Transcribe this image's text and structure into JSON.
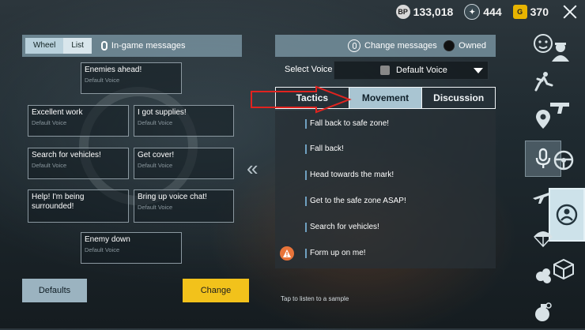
{
  "currency": {
    "bp_label": "BP",
    "bp_value": "133,018",
    "uc_value": "444",
    "g_label": "G",
    "g_value": "370"
  },
  "left_panel": {
    "tabs": [
      "Wheel",
      "List"
    ],
    "ingame_label": "In-game messages",
    "slots": [
      {
        "title": "Enemies ahead!",
        "sub": "Default Voice"
      },
      {
        "title": "Excellent work",
        "sub": "Default Voice"
      },
      {
        "title": "I got supplies!",
        "sub": "Default Voice"
      },
      {
        "title": "Search for vehicles!",
        "sub": "Default Voice"
      },
      {
        "title": "Get cover!",
        "sub": "Default Voice"
      },
      {
        "title": "Help! I'm being surrounded!",
        "sub": ""
      },
      {
        "title": "Bring up voice chat!",
        "sub": "Default Voice"
      },
      {
        "title": "Enemy down",
        "sub": "Default Voice"
      }
    ],
    "defaults_label": "Defaults",
    "change_label": "Change",
    "arrows": "«"
  },
  "right_panel": {
    "change_messages_label": "Change messages",
    "owned_label": "Owned",
    "select_voice_label": "Select Voice",
    "voice_value": "Default Voice",
    "categories": [
      "Tactics",
      "Movement",
      "Discussion"
    ],
    "selected_category": "Movement",
    "messages": [
      "Fall back to safe zone!",
      "Fall back!",
      "Head towards the mark!",
      "Get to the safe zone ASAP!",
      "Search for vehicles!",
      "Form up on me!"
    ],
    "tap_hint": "Tap to listen to a sample"
  },
  "sidebar": {
    "icons": [
      "emote-icon",
      "character-icon",
      "run-icon",
      "gun-icon",
      "location-icon",
      "steering-wheel-icon",
      "microphone-icon",
      "airplane-icon",
      "parachute-icon",
      "smoke-icon",
      "box-icon",
      "grenade-icon"
    ],
    "selected": "microphone-icon",
    "highlight_color": "#cde2ea"
  },
  "colors": {
    "accent_yellow": "#f2c21b",
    "annotation_red": "#e0231f"
  }
}
